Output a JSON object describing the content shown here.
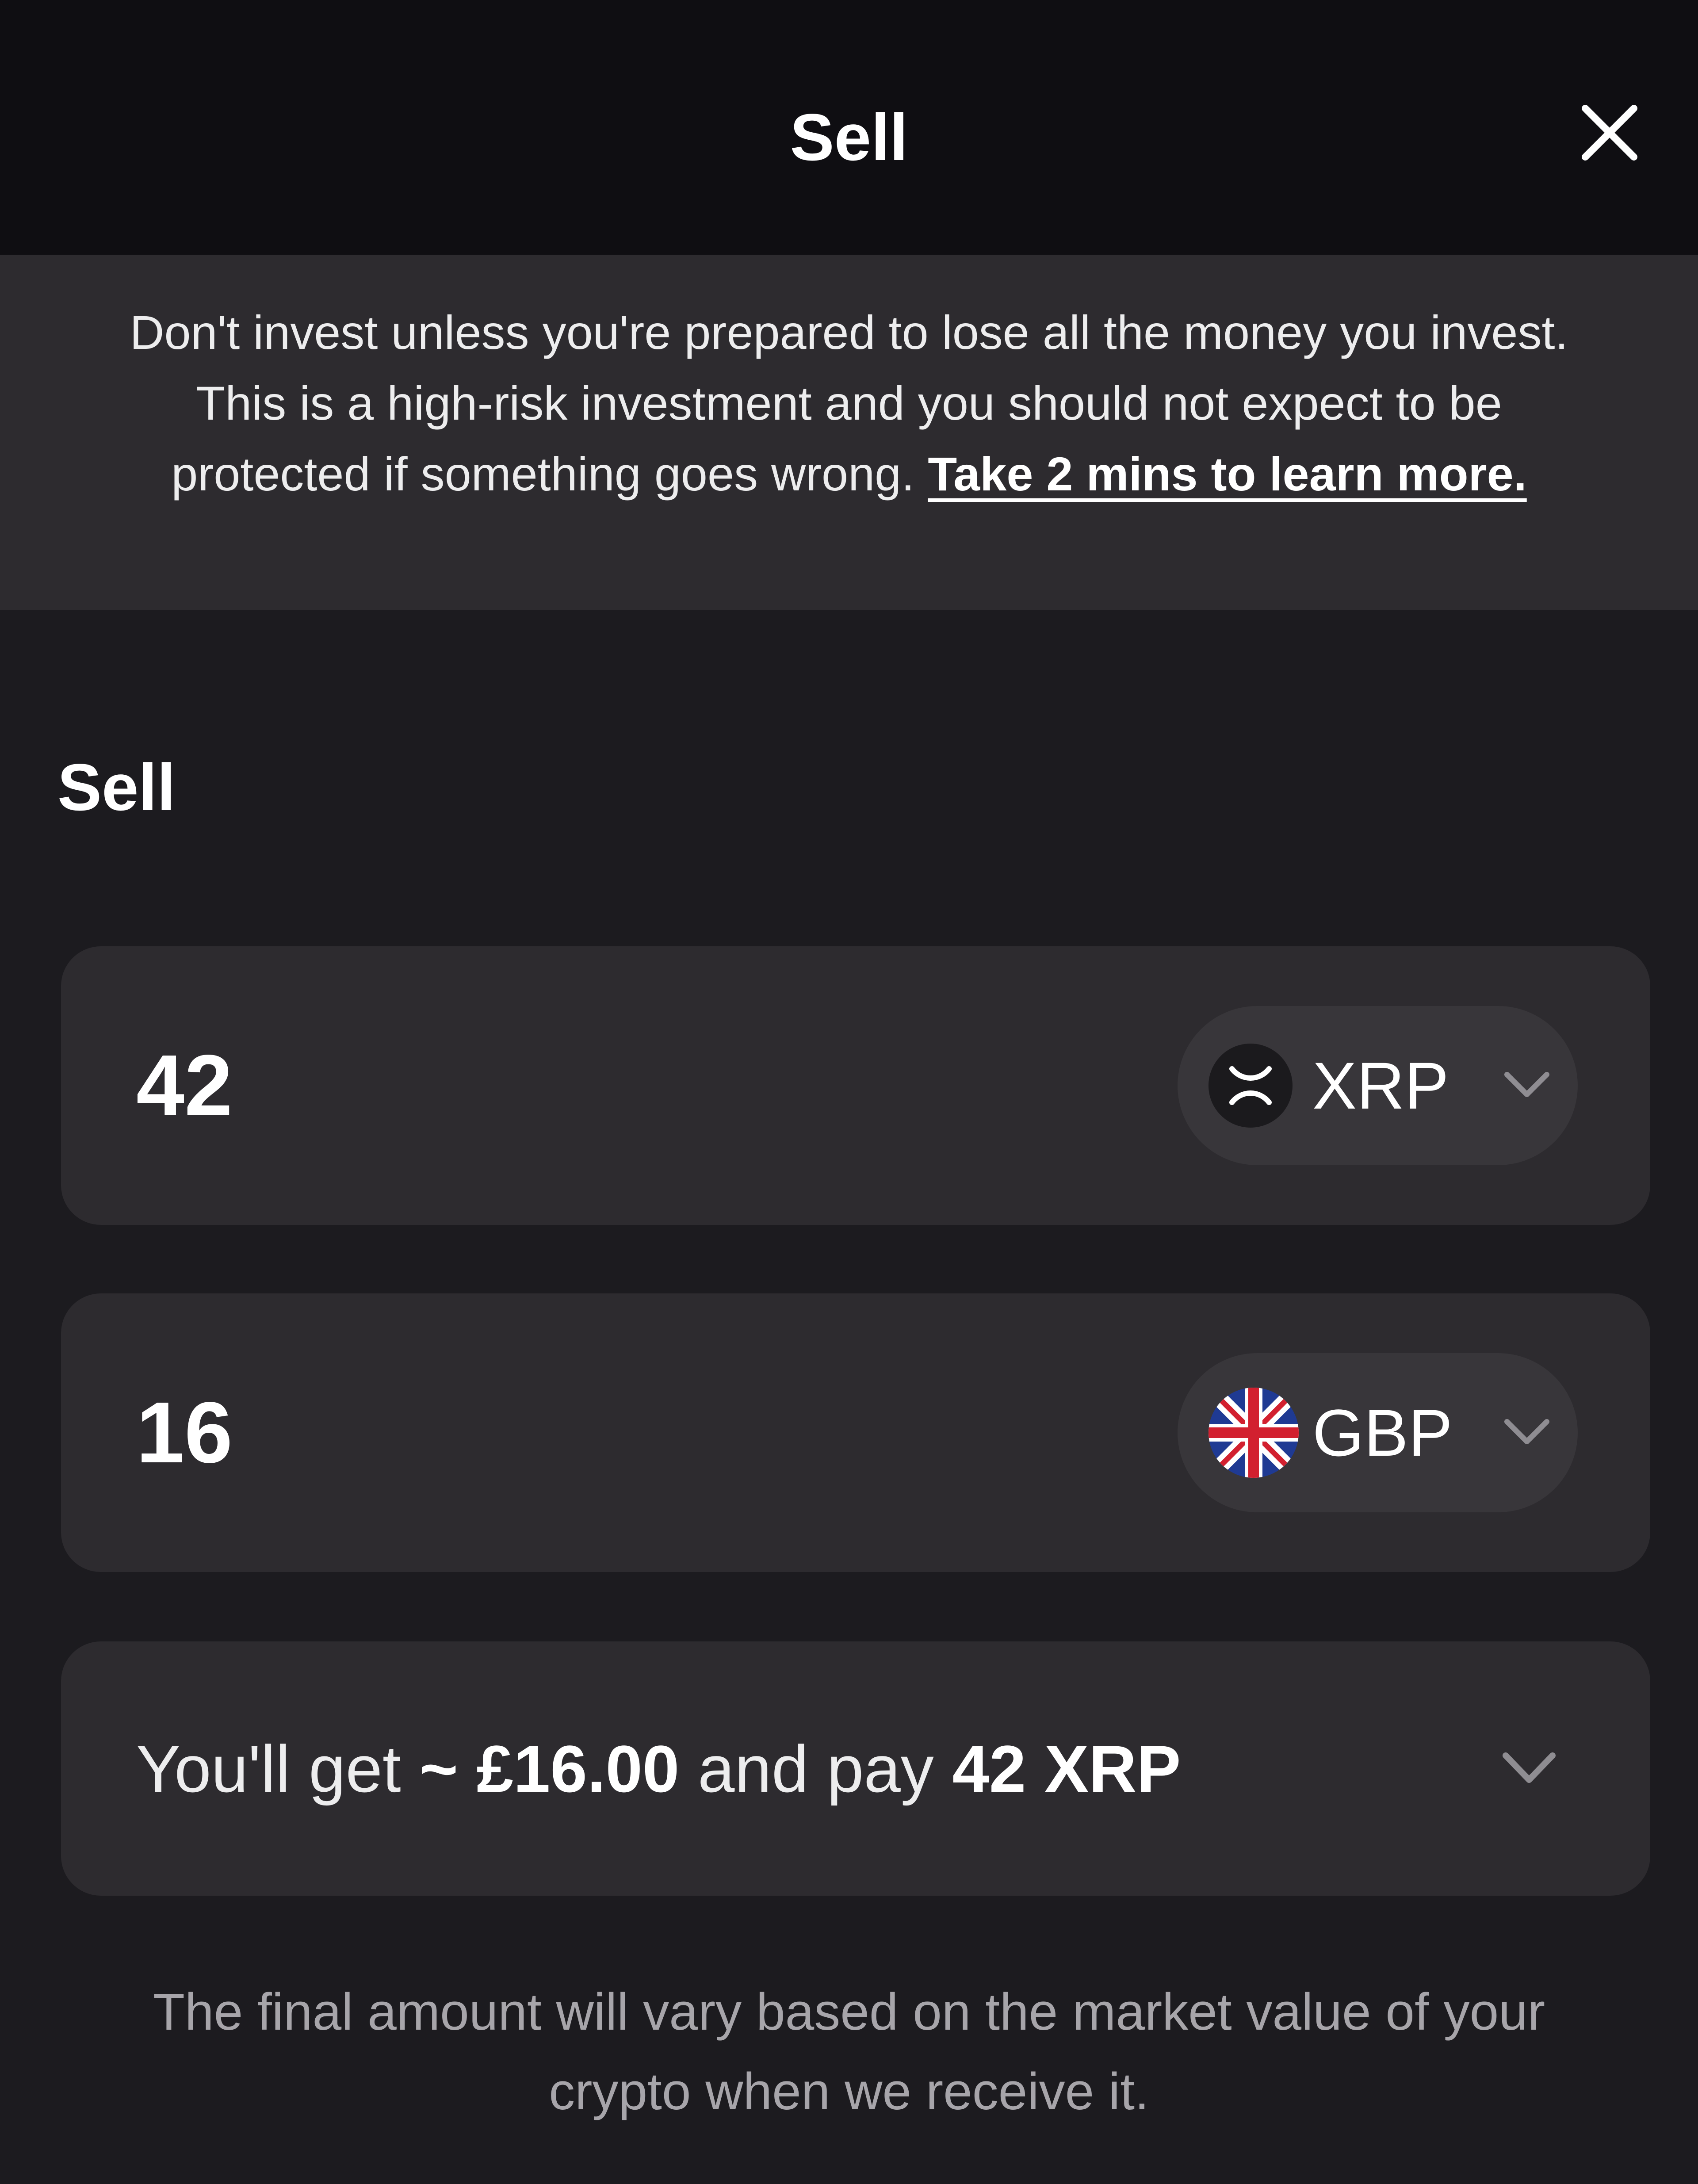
{
  "header": {
    "title": "Sell",
    "close_icon": "close-icon"
  },
  "warning_banner": {
    "text": "Don't invest unless you're prepared to lose all the money you invest. This is a high-risk investment and you should not expect to be protected if something goes wrong.",
    "link_text": "Take 2 mins to learn more."
  },
  "section_label": "Sell",
  "crypto_input": {
    "value": "42",
    "currency": "XRP",
    "icon": "xrp-coin-icon"
  },
  "fiat_input": {
    "value": "16",
    "currency": "GBP",
    "icon": "uk-flag-icon"
  },
  "summary": {
    "prefix": "You'll get",
    "get_amount": "~ £16.00",
    "middle": "and pay",
    "pay_amount": "42 XRP"
  },
  "footnote": "The final amount will vary based on the market value of your crypto when we receive it.",
  "colors": {
    "background": "#1c1b1f",
    "header_background": "#0f0e12",
    "card_background": "#2d2b2f",
    "pill_background": "#38363a",
    "muted_text": "#a7a5aa"
  }
}
